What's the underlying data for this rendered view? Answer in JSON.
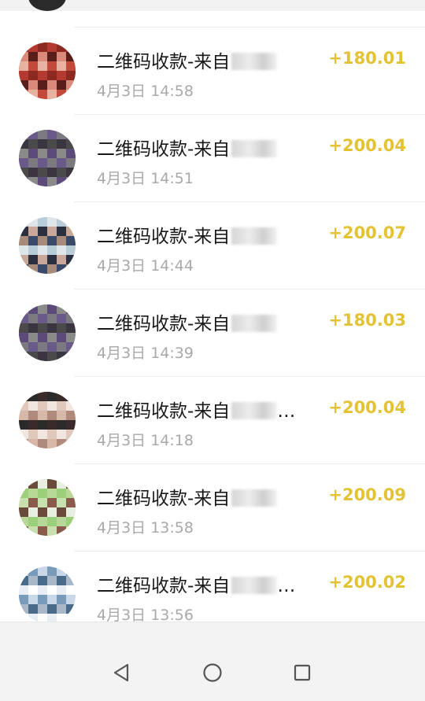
{
  "transactions": [
    {
      "title": "二维码收款-来自",
      "time": "4月3日 14:58",
      "amount": "+180.01",
      "avatar_colors": [
        "#8c2a22",
        "#d98a7a",
        "#e7b2a0",
        "#b23a30",
        "#5a1e1a",
        "#c24a3a"
      ]
    },
    {
      "title": "二维码收款-来自",
      "time": "4月3日 14:51",
      "amount": "+200.04",
      "avatar_colors": [
        "#5b4a7a",
        "#7a7a80",
        "#3a3540",
        "#8a8a88",
        "#6a5a8a",
        "#4a4a4a"
      ]
    },
    {
      "title": "二维码收款-来自",
      "time": "4月3日 14:44",
      "amount": "+200.07",
      "avatar_colors": [
        "#c9a89a",
        "#3a4a6a",
        "#b9cdd8",
        "#2a3040",
        "#a88a7a",
        "#dfe6ea"
      ]
    },
    {
      "title": "二维码收款-来自",
      "time": "4月3日 14:39",
      "amount": "+180.03",
      "avatar_colors": [
        "#5b4a7a",
        "#7a7a80",
        "#3a3540",
        "#8a8a88",
        "#6a5a8a",
        "#4a4a4a"
      ]
    },
    {
      "title": "二维码收款-来自",
      "time": "4月3日 14:18",
      "amount": "+200.04",
      "avatar_colors": [
        "#d8b8a8",
        "#2a2a2a",
        "#f2e6e0",
        "#b08a7a",
        "#3a2a2a",
        "#e0c8bc"
      ]
    },
    {
      "title": "二维码收款-来自",
      "time": "4月3日 13:58",
      "amount": "+200.09",
      "avatar_colors": [
        "#9ccf7a",
        "#c8e0b0",
        "#6a4a3a",
        "#b8d898",
        "#8a5a4a",
        "#e8efe0"
      ]
    },
    {
      "title": "二维码收款-来自",
      "time": "4月3日 13:56",
      "amount": "+200.02",
      "avatar_colors": [
        "#c8d8e8",
        "#4a6a8a",
        "#e8eef4",
        "#7a9aba",
        "#a8b8c8",
        "#ffffff"
      ]
    }
  ],
  "title_suffixes": [
    "",
    "",
    "",
    "",
    "…",
    "",
    "…"
  ],
  "colors": {
    "amount": "#e3c233",
    "time": "#a9a9a9",
    "title": "#1a1a1a"
  },
  "nav": {
    "back_icon": "back-triangle-icon",
    "home_icon": "home-circle-icon",
    "recent_icon": "recents-square-icon"
  }
}
